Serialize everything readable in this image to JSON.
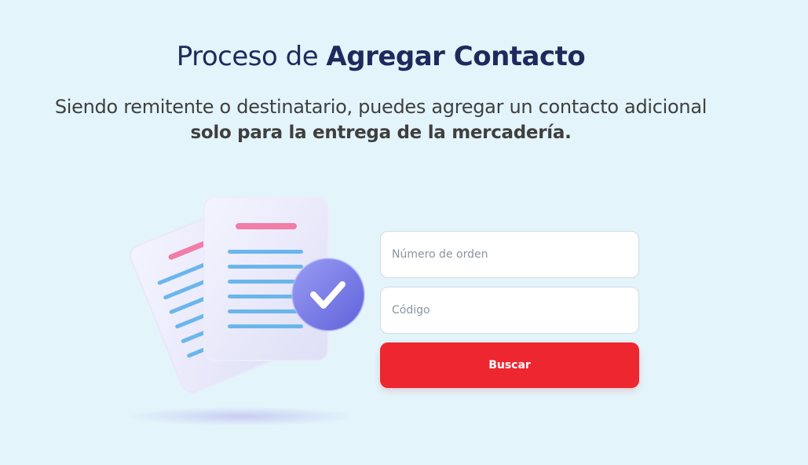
{
  "header": {
    "title_regular": "Proceso de ",
    "title_bold": "Agregar Contacto",
    "subtitle_line1": "Siendo remitente o destinatario, puedes agregar un contacto adicional",
    "subtitle_line2": "solo para la entrega de la mercadería."
  },
  "form": {
    "order_number_placeholder": "Número de orden",
    "code_placeholder": "Código",
    "search_button_label": "Buscar"
  },
  "illustration": {
    "icon": "documents-checkmark-icon"
  },
  "colors": {
    "background": "#e3f4fb",
    "title": "#1f2a5c",
    "button": "#ee262f",
    "check_badge": "#7b7fe8"
  }
}
